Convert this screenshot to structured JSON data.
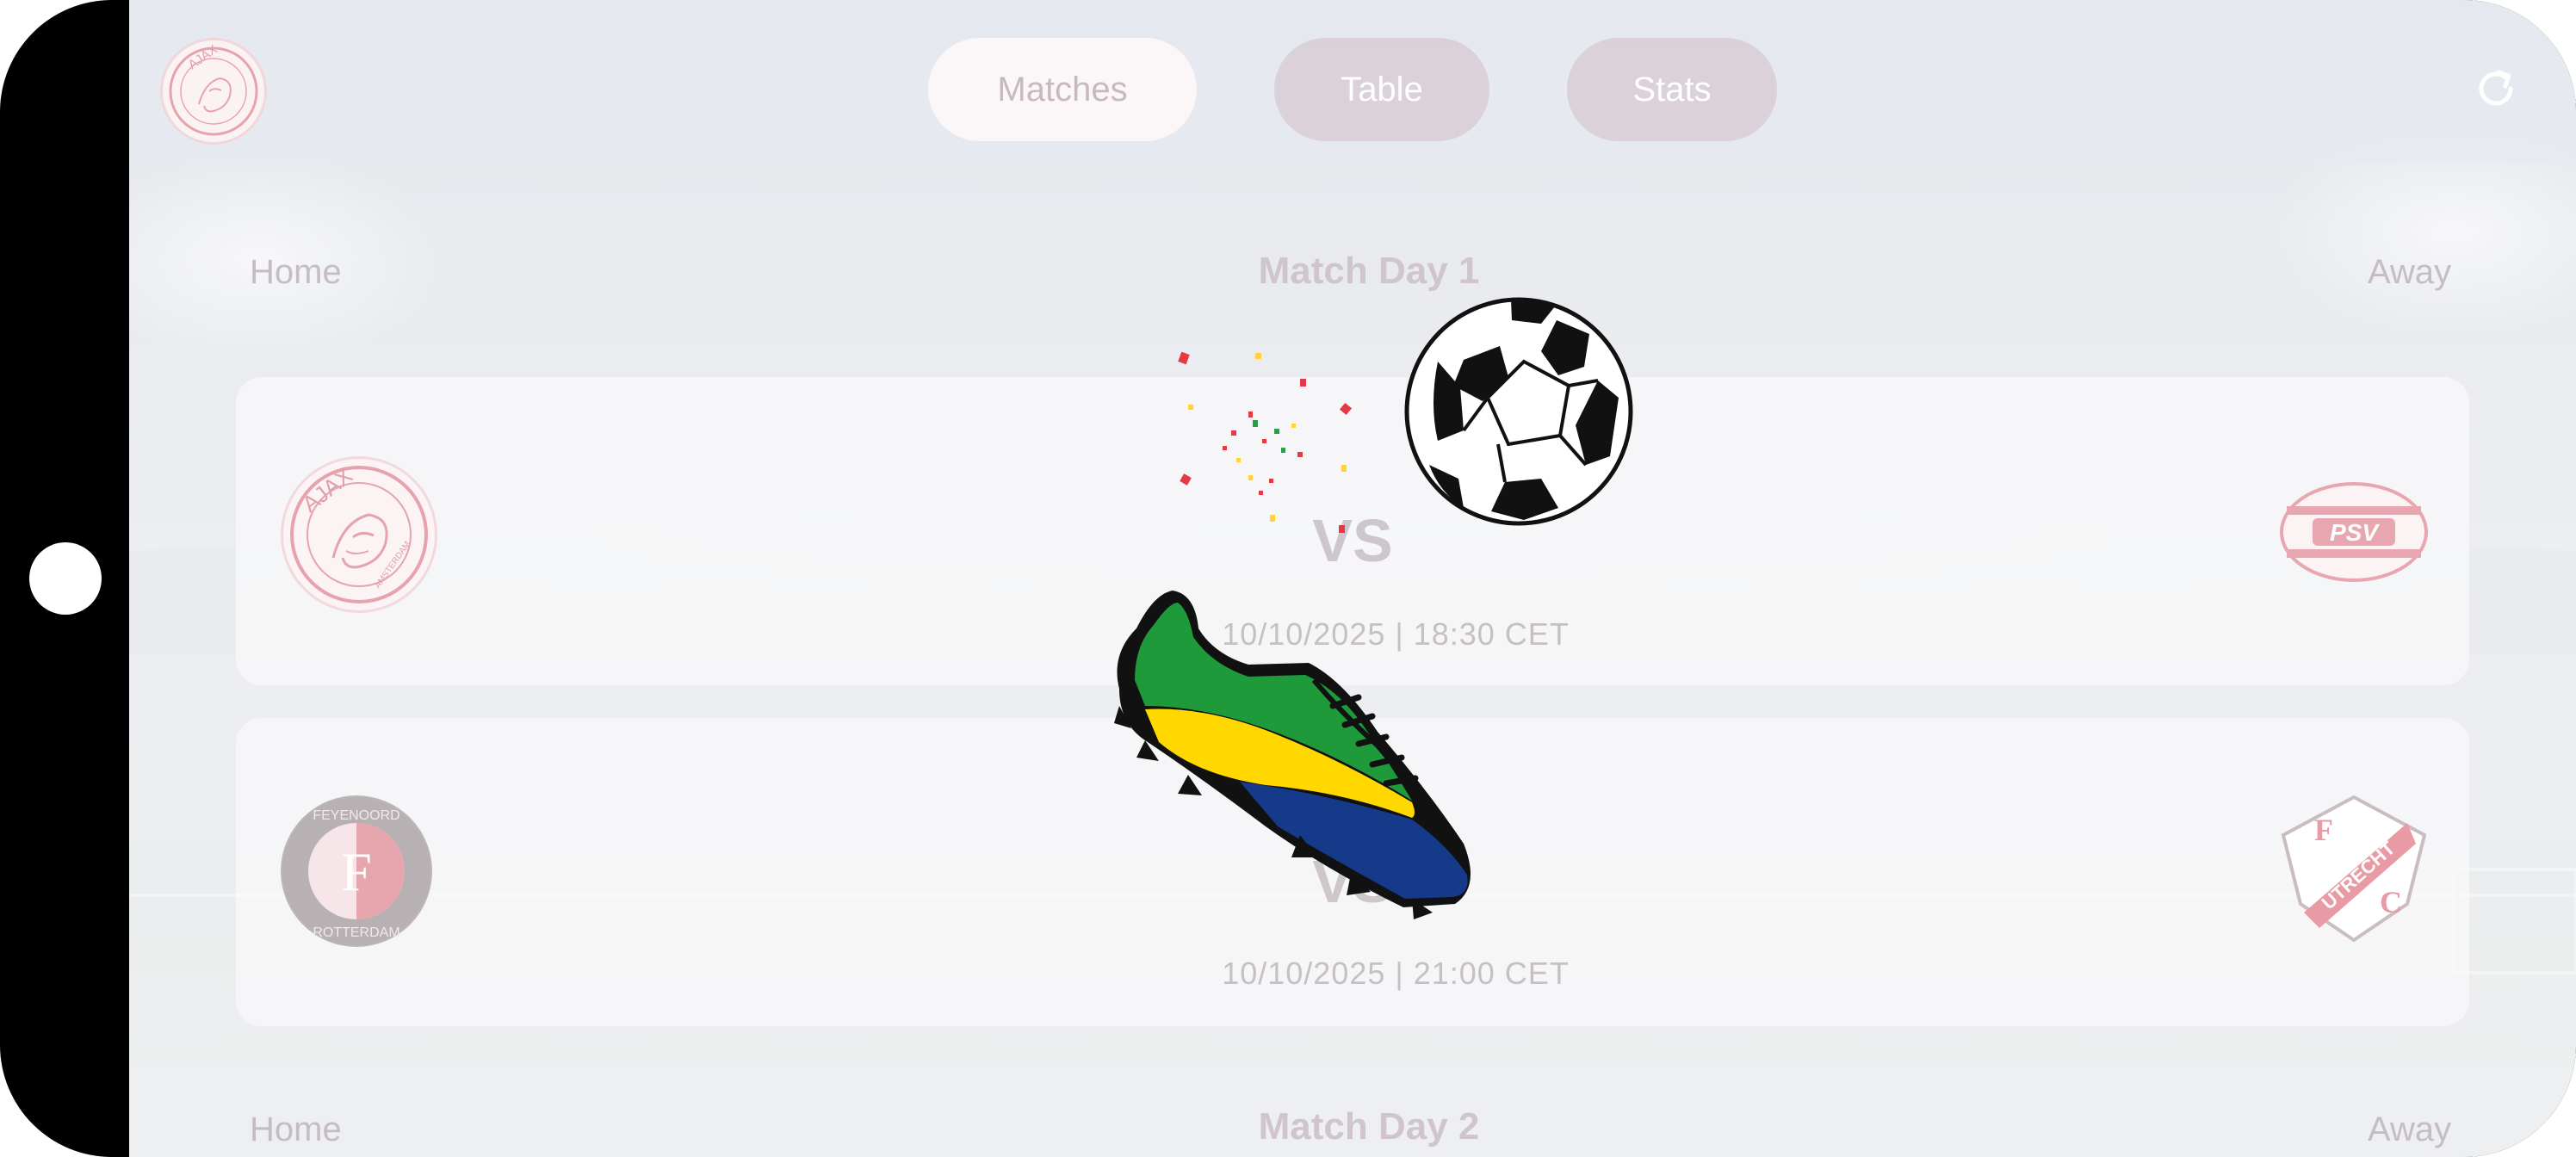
{
  "tabs": [
    {
      "label": "Matches",
      "active": true
    },
    {
      "label": "Table",
      "active": false
    },
    {
      "label": "Stats",
      "active": false
    }
  ],
  "matchdays": [
    {
      "title": "Match Day 1",
      "home_label": "Home",
      "away_label": "Away",
      "matches": [
        {
          "home": "AJAX AMSTERDAM",
          "away": "PSV",
          "vs": "VS",
          "datetime": "10/10/2025 | 18:30 CET"
        },
        {
          "home": "FEYENOORD ROTTERDAM",
          "away": "FC UTRECHT",
          "vs": "VS",
          "datetime": "10/10/2025 | 21:00 CET"
        }
      ]
    },
    {
      "title": "Match Day 2",
      "home_label": "Home",
      "away_label": "Away"
    }
  ],
  "logos": {
    "ajax_text": "AJAX",
    "ajax_small": "AMSTERDAM",
    "psv_text": "PSV",
    "feyenoord_top": "FEYENOORD",
    "feyenoord_bottom": "ROTTERDAM",
    "feyenoord_letter": "F",
    "utrecht_text": "UTRECHT",
    "utrecht_f": "F",
    "utrecht_c": "C"
  },
  "icons": {
    "refresh": "refresh-icon",
    "ball": "soccer-ball-icon",
    "boot": "football-boot-icon"
  },
  "colors": {
    "ajax_red": "#e7a3ad",
    "psv_red": "#e8a7b0",
    "feyenoord_red": "#e7a6ad",
    "utrecht_red": "#e89aa5",
    "boot_green": "#1e9a3b",
    "boot_yellow": "#ffd800",
    "boot_blue": "#163a8a"
  }
}
